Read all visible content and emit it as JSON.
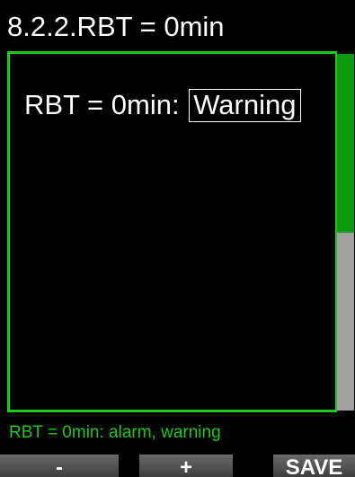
{
  "header": {
    "title": "8.2.2.RBT = 0min"
  },
  "setting": {
    "label": "RBT = 0min:",
    "value": "Warning"
  },
  "scrollbar": {
    "position_fraction": 0.5
  },
  "status": {
    "text": "RBT = 0min: alarm, warning"
  },
  "softkeys": {
    "minus": "-",
    "plus": "+",
    "save": "SAVE"
  },
  "colors": {
    "accent": "#1ec81e",
    "scroll_thumb": "#0a9a0a",
    "scroll_track": "#a0a0a0",
    "background": "#000000"
  }
}
